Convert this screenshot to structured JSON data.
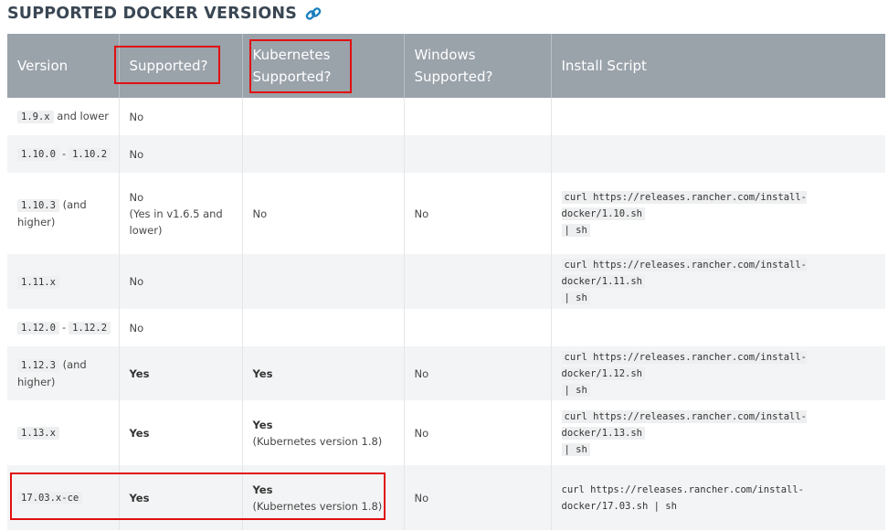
{
  "heading": {
    "title": "SUPPORTED DOCKER VERSIONS",
    "icon": "link-icon"
  },
  "table": {
    "headers": {
      "version": "Version",
      "supported": "Supported?",
      "k8s_line1": "Kubernetes",
      "k8s_line2": "Supported?",
      "win_line1": "Windows",
      "win_line2": "Supported?",
      "script": "Install Script"
    },
    "rows": [
      {
        "version_code": "1.9.x",
        "version_text": "and lower",
        "supported": "No",
        "kubernetes": "",
        "windows": "",
        "script": []
      },
      {
        "version_code": "1.10.0",
        "version_sep": "-",
        "version_code2": "1.10.2",
        "supported": "No",
        "kubernetes": "",
        "windows": "",
        "script": []
      },
      {
        "version_code": "1.10.3",
        "version_text": "(and higher)",
        "supported": "No",
        "supported_note": "(Yes in v1.6.5 and lower)",
        "kubernetes": "No",
        "windows": "No",
        "script": [
          "curl https://releases.rancher.com/install-docker/1.10.sh",
          "| sh"
        ]
      },
      {
        "version_code": "1.11.x",
        "supported": "No",
        "kubernetes": "",
        "windows": "",
        "script": [
          "curl https://releases.rancher.com/install-docker/1.11.sh",
          "| sh"
        ]
      },
      {
        "version_code": "1.12.0",
        "version_sep": "-",
        "version_code2": "1.12.2",
        "supported": "No",
        "kubernetes": "",
        "windows": "",
        "script": []
      },
      {
        "version_code": "1.12.3",
        "version_text": "(and higher)",
        "supported": "Yes",
        "kubernetes": "Yes",
        "windows": "No",
        "script": [
          "curl https://releases.rancher.com/install-docker/1.12.sh",
          "| sh"
        ]
      },
      {
        "version_code": "1.13.x",
        "supported": "Yes",
        "kubernetes": "Yes",
        "kubernetes_note": "(Kubernetes version 1.8)",
        "windows": "No",
        "script": [
          "curl https://releases.rancher.com/install-docker/1.13.sh",
          "| sh"
        ]
      },
      {
        "version_code": "17.03.x-ce",
        "supported": "Yes",
        "kubernetes": "Yes",
        "kubernetes_note": "(Kubernetes version 1.8)",
        "windows": "No",
        "script": [
          "curl https://releases.rancher.com/install-",
          "docker/17.03.sh | sh"
        ]
      }
    ]
  },
  "colors": {
    "header_bg": "#9aa2aa",
    "highlight_border": "#e10f10",
    "link_icon": "#1a7fbf",
    "alt_row": "#f3f4f5"
  }
}
